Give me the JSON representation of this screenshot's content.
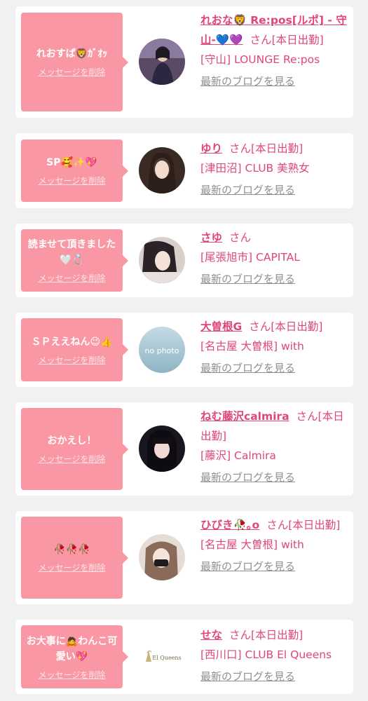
{
  "delete_label": "メッセージを削除",
  "blog_label": "最新のブログを見る",
  "san_label": "さん",
  "colors": {
    "bubble": "#fa97a4",
    "accent": "#e0457b",
    "muted": "#8f8f8f",
    "card": "#ffffff",
    "background": "#f1f1f1"
  },
  "items": [
    {
      "message": "れおすぱ🦁ｶﾞｵｯ",
      "name": "れおな🦁 Re:pos[ルポ] - 守山-💙💜",
      "status": "[本日出勤]",
      "shop": "[守山] LOUNGE Re:pos",
      "avatar_icon": "woman-photo"
    },
    {
      "message": "SP🥰✨💖",
      "name": "ゆり",
      "status": "[本日出勤]",
      "shop": "[津田沼] CLUB 美熟女",
      "avatar_icon": "woman-photo"
    },
    {
      "message": "読ませて頂きました🤍💍",
      "name": "さゆ",
      "status": "",
      "shop": "[尾張旭市] CAPITAL",
      "avatar_icon": "woman-photo"
    },
    {
      "message": "ＳＰええねん😉👍",
      "name": "大曽根G",
      "status": "[本日出勤]",
      "shop": "[名古屋 大曽根] with",
      "avatar_icon": "no-photo",
      "avatar_text": "no photo"
    },
    {
      "message": "おかえし！",
      "name": "ねむ藤沢calmira",
      "status": "[本日出勤]",
      "shop": "[藤沢] Calmira",
      "avatar_icon": "woman-photo"
    },
    {
      "message": "🥀🥀🥀",
      "name": "ひびき🥀｡o",
      "status": "[本日出勤]",
      "shop": "[名古屋 大曽根] with",
      "avatar_icon": "woman-photo"
    },
    {
      "message": "お大事に🙇わんこ可愛い💖",
      "name": "せな",
      "status": "[本日出勤]",
      "shop": "[西川口] CLUB El Queens",
      "avatar_icon": "shop-logo",
      "avatar_text": "El Queens"
    }
  ]
}
